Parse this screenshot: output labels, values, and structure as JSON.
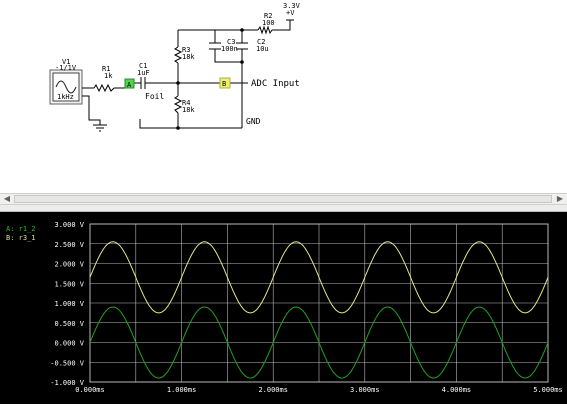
{
  "schematic": {
    "source": {
      "name": "V1",
      "amplitude": "-1/1V",
      "frequency": "1kHz"
    },
    "r1": {
      "name": "R1",
      "value": "1k"
    },
    "c1": {
      "name": "C1",
      "value": "1uF"
    },
    "node_a": "A",
    "foil_label": "Foil",
    "r3": {
      "name": "R3",
      "value": "18k"
    },
    "r4": {
      "name": "R4",
      "value": "18k"
    },
    "c3": {
      "name": "C3",
      "value": "100n"
    },
    "c2": {
      "name": "C2",
      "value": "10u"
    },
    "r2": {
      "name": "R2",
      "value": "100"
    },
    "supply": {
      "voltage": "3.3V",
      "symbol": "+V"
    },
    "node_b": "B",
    "adc_label": "ADC Input",
    "gnd_label": "GND"
  },
  "scope": {
    "legend": {
      "a": "A: r1_2",
      "b": "B: r3_1"
    },
    "colors": {
      "background": "#000000",
      "grid": "#b8b8b8",
      "trace_a": "#22a022",
      "trace_b": "#e6e68a",
      "legend_a": "#22c022",
      "legend_b": "#e0e080",
      "labels": "#ffffff"
    },
    "y_ticks": [
      "3.000 V",
      "2.500 V",
      "2.000 V",
      "1.500 V",
      "1.000 V",
      "0.500 V",
      "0.000 V",
      "-0.500 V",
      "-1.000 V"
    ],
    "x_ticks": [
      "0.000ms",
      "1.000ms",
      "2.000ms",
      "3.000ms",
      "4.000ms",
      "5.000ms"
    ]
  },
  "chart_data": {
    "type": "line",
    "ylim": [
      -1.0,
      3.0
    ],
    "xlim": [
      0.0,
      5.0
    ],
    "grid": true,
    "legend": "top-left",
    "series": [
      {
        "name": "A: r1_2",
        "color": "#22a022",
        "function": "sine",
        "offset_v": 0.0,
        "amplitude_v": 0.9,
        "frequency_khz": 1.0,
        "phase_deg": 0
      },
      {
        "name": "B: r3_1",
        "color": "#e6e68a",
        "function": "sine",
        "offset_v": 1.65,
        "amplitude_v": 0.9,
        "frequency_khz": 1.0,
        "phase_deg": 0
      }
    ]
  }
}
